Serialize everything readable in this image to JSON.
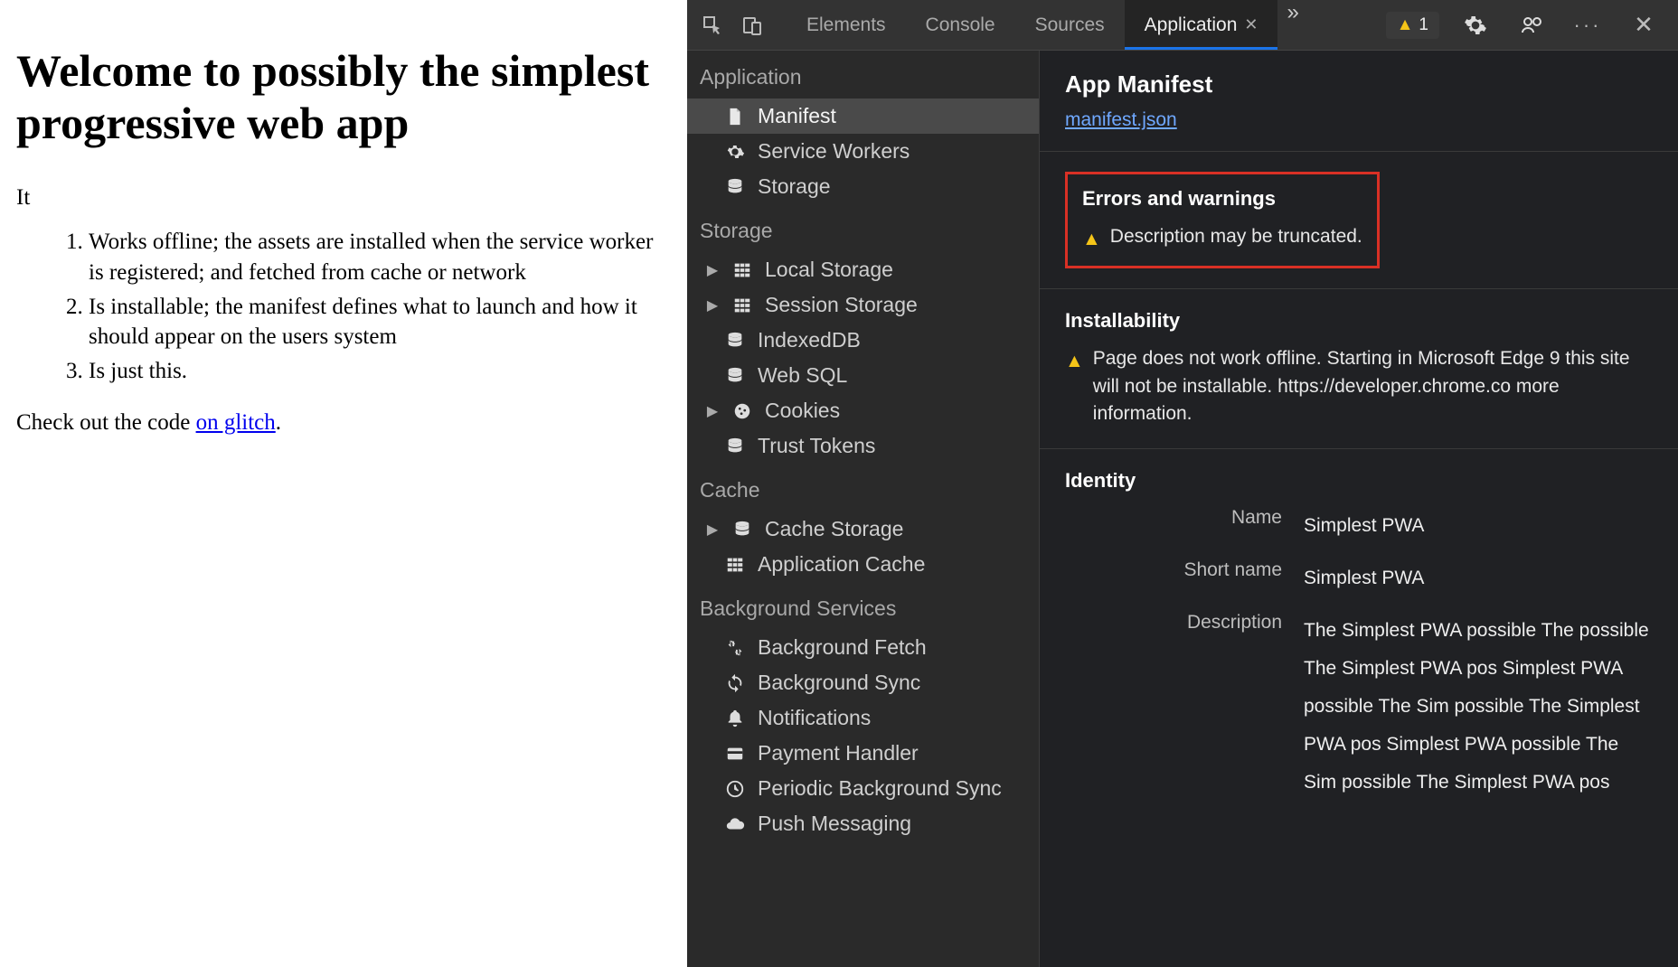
{
  "page": {
    "title": "Welcome to possibly the simplest progressive web app",
    "intro": "It",
    "items": [
      "Works offline; the assets are installed when the service worker is registered; and fetched from cache or network",
      "Is installable; the manifest defines what to launch and how it should appear on the users system",
      "Is just this."
    ],
    "outro_pre": "Check out the code ",
    "outro_link": "on glitch",
    "outro_post": "."
  },
  "toolbar": {
    "tabs": [
      {
        "label": "Elements",
        "active": false
      },
      {
        "label": "Console",
        "active": false
      },
      {
        "label": "Sources",
        "active": false
      },
      {
        "label": "Application",
        "active": true
      }
    ],
    "overflow": "»",
    "warn_count": "1"
  },
  "sidebar": {
    "groups": [
      {
        "title": "Application",
        "items": [
          {
            "label": "Manifest",
            "icon": "file",
            "selected": true
          },
          {
            "label": "Service Workers",
            "icon": "gear"
          },
          {
            "label": "Storage",
            "icon": "db"
          }
        ]
      },
      {
        "title": "Storage",
        "items": [
          {
            "label": "Local Storage",
            "icon": "grid",
            "arrow": true
          },
          {
            "label": "Session Storage",
            "icon": "grid",
            "arrow": true
          },
          {
            "label": "IndexedDB",
            "icon": "db"
          },
          {
            "label": "Web SQL",
            "icon": "db"
          },
          {
            "label": "Cookies",
            "icon": "cookie",
            "arrow": true
          },
          {
            "label": "Trust Tokens",
            "icon": "db"
          }
        ]
      },
      {
        "title": "Cache",
        "items": [
          {
            "label": "Cache Storage",
            "icon": "db",
            "arrow": true
          },
          {
            "label": "Application Cache",
            "icon": "grid"
          }
        ]
      },
      {
        "title": "Background Services",
        "items": [
          {
            "label": "Background Fetch",
            "icon": "fetch"
          },
          {
            "label": "Background Sync",
            "icon": "sync"
          },
          {
            "label": "Notifications",
            "icon": "bell"
          },
          {
            "label": "Payment Handler",
            "icon": "card"
          },
          {
            "label": "Periodic Background Sync",
            "icon": "clock"
          },
          {
            "label": "Push Messaging",
            "icon": "cloud"
          }
        ]
      }
    ]
  },
  "detail": {
    "title": "App Manifest",
    "manifest_link": "manifest.json",
    "errors_title": "Errors and warnings",
    "errors_warn": "Description may be truncated.",
    "install_title": "Installability",
    "install_warn": "Page does not work offline. Starting in Microsoft Edge 9 this site will not be installable. https://developer.chrome.co more information.",
    "identity_title": "Identity",
    "fields": [
      {
        "label": "Name",
        "value": "Simplest PWA"
      },
      {
        "label": "Short name",
        "value": "Simplest PWA"
      },
      {
        "label": "Description",
        "value": "The Simplest PWA possible The possible The Simplest PWA pos Simplest PWA possible The Sim possible The Simplest PWA pos Simplest PWA possible The Sim possible The Simplest PWA pos"
      }
    ]
  }
}
